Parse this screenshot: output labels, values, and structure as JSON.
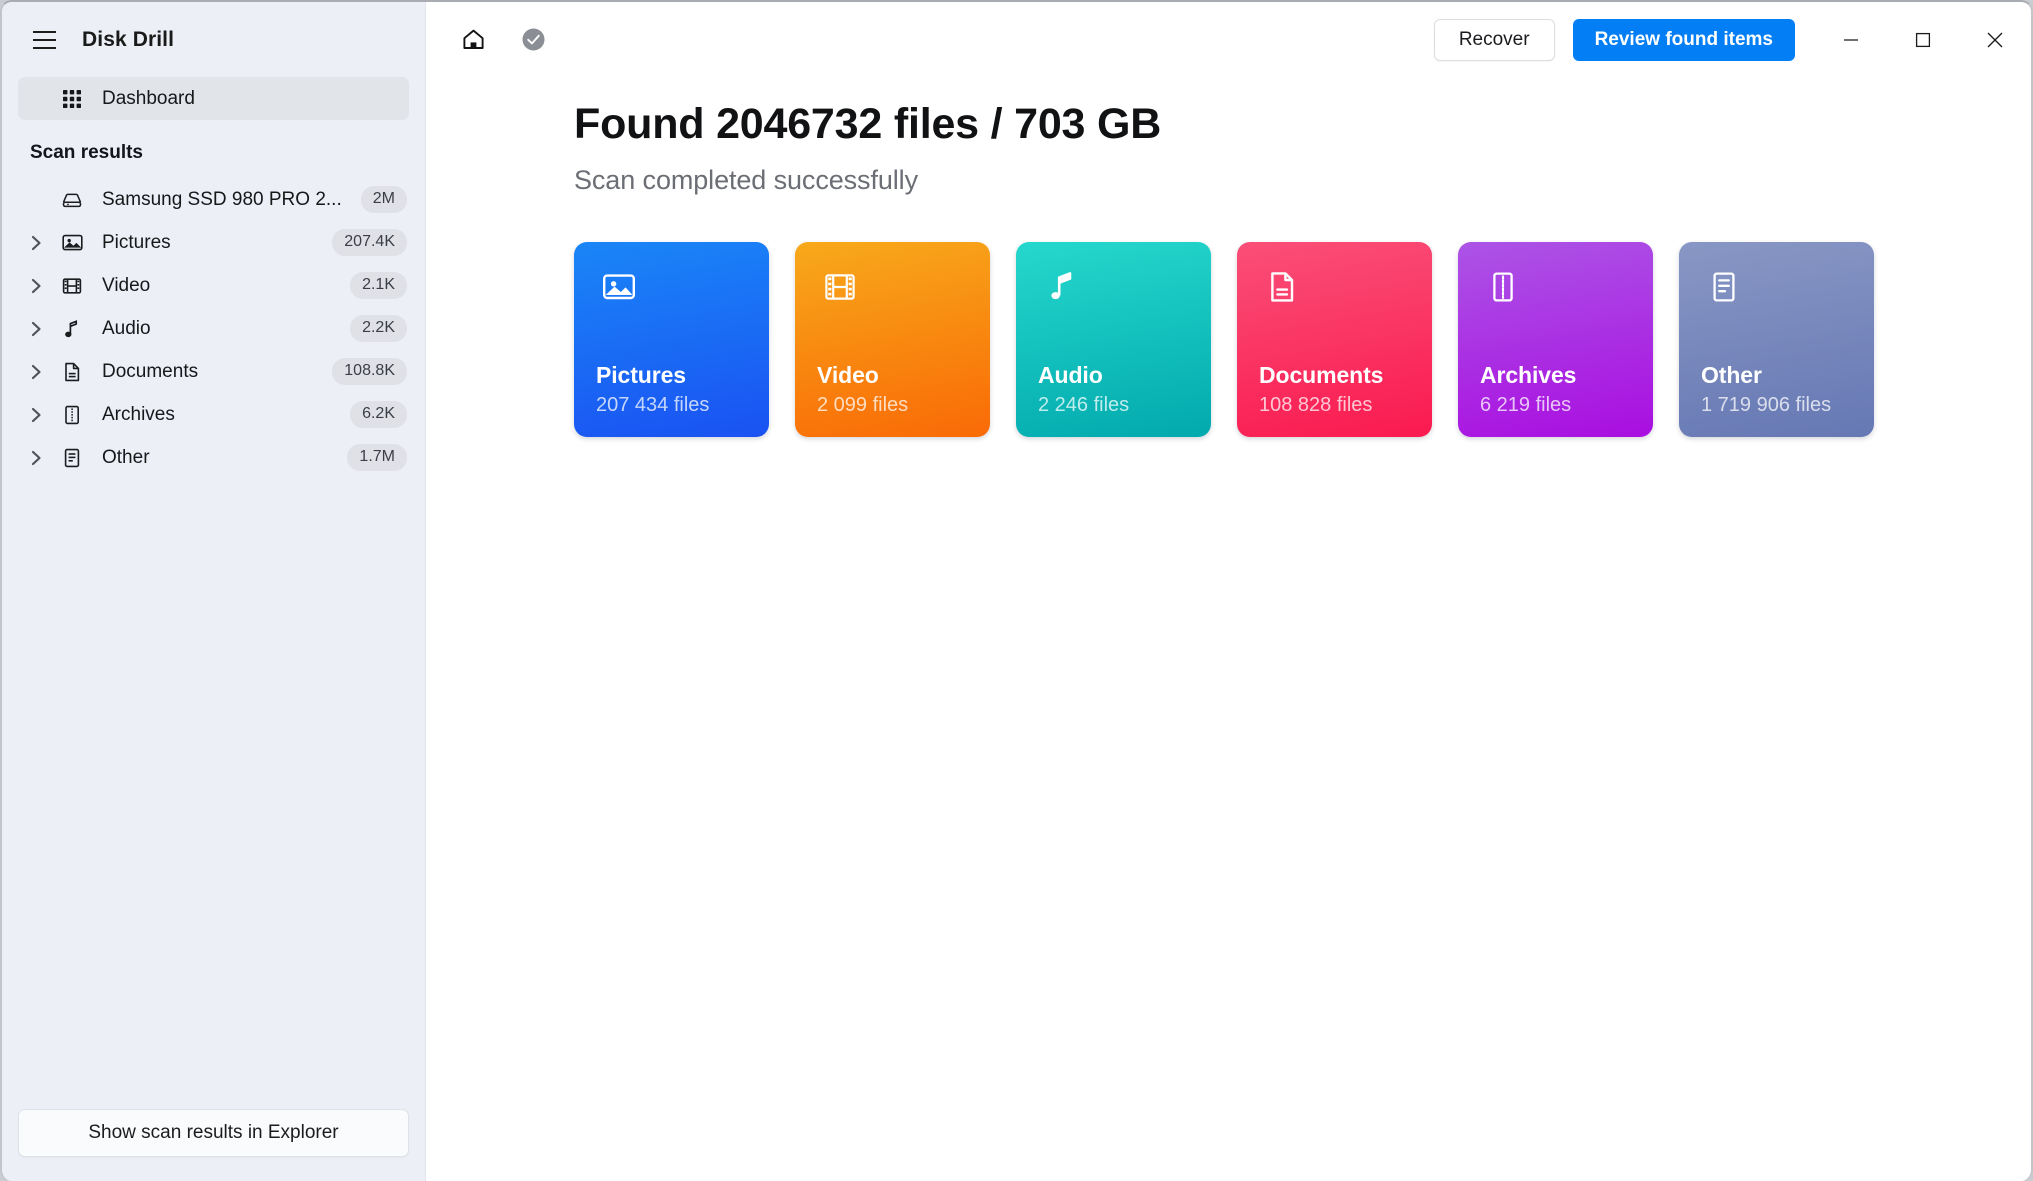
{
  "app": {
    "title": "Disk Drill",
    "menu_icon": "hamburger-icon"
  },
  "sidebar": {
    "dashboard": {
      "label": "Dashboard",
      "icon": "grid-icon"
    },
    "section_label": "Scan results",
    "items": [
      {
        "label": "Samsung SSD 980 PRO 2...",
        "badge": "2M",
        "icon": "disk-icon",
        "expandable": false
      },
      {
        "label": "Pictures",
        "badge": "207.4K",
        "icon": "picture-icon",
        "expandable": true
      },
      {
        "label": "Video",
        "badge": "2.1K",
        "icon": "film-icon",
        "expandable": true
      },
      {
        "label": "Audio",
        "badge": "2.2K",
        "icon": "music-note-icon",
        "expandable": true
      },
      {
        "label": "Documents",
        "badge": "108.8K",
        "icon": "document-icon",
        "expandable": true
      },
      {
        "label": "Archives",
        "badge": "6.2K",
        "icon": "archive-icon",
        "expandable": true
      },
      {
        "label": "Other",
        "badge": "1.7M",
        "icon": "list-doc-icon",
        "expandable": true
      }
    ],
    "footer_button": "Show scan results in Explorer"
  },
  "topbar": {
    "home_icon": "home-icon",
    "status_icon": "check-circle-icon",
    "recover_label": "Recover",
    "review_label": "Review found items",
    "minimize": "minimize-icon",
    "maximize": "maximize-icon",
    "close": "close-icon"
  },
  "main": {
    "headline": "Found 2046732 files / 703 GB",
    "subhead": "Scan completed successfully",
    "cards": [
      {
        "title": "Pictures",
        "count": "207 434 files",
        "icon": "picture-icon",
        "color": "#1a6df5"
      },
      {
        "title": "Video",
        "count": "2 099 files",
        "icon": "film-icon",
        "color": "#f8890f"
      },
      {
        "title": "Audio",
        "count": "2 246 files",
        "icon": "music-note-icon",
        "color": "#13c0bd"
      },
      {
        "title": "Documents",
        "count": "108 828 files",
        "icon": "document-icon",
        "color": "#fa3562"
      },
      {
        "title": "Archives",
        "count": "6 219 files",
        "icon": "archive-icon",
        "color": "#a932e3"
      },
      {
        "title": "Other",
        "count": "1 719 906 files",
        "icon": "list-doc-icon",
        "color": "#7787bc"
      }
    ]
  },
  "colors": {
    "accent": "#047ef4",
    "sidebar_bg": "#eceff6",
    "selected_bg": "#e1e4e9",
    "badge_bg": "#dfe1e6"
  }
}
